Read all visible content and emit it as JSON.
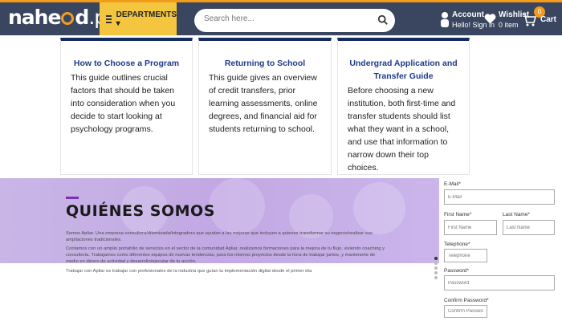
{
  "header": {
    "logo_prefix": "nahe",
    "logo_suffix": "d",
    "logo_tld": ".pk",
    "departments_label": "DEPARTMENTS ▾",
    "search_placeholder": "Search here...",
    "account_label": "Account",
    "account_sub": "Hello! Sign in",
    "wishlist_label": "Wishlist",
    "wishlist_sub": "0 item",
    "cart_label": "Cart",
    "cart_count": "0",
    "colors": {
      "bar": "#3a4660",
      "accent": "#f39b1a",
      "departments_bg": "#f4c63f"
    }
  },
  "cards": [
    {
      "title": "How to Choose a Program",
      "body": "This guide outlines crucial factors that should be taken into consideration when you decide to start looking at psychology programs."
    },
    {
      "title": "Returning to School",
      "body": "This guide gives an overview of credit transfers, prior learning assessments, online degrees, and financial aid for students returning to school."
    },
    {
      "title": "Undergrad Application and Transfer Guide",
      "body": "Before choosing a new institution, both first-time and transfer students should list what they want in a school, and use that information to narrow down their top choices."
    }
  ],
  "hero": {
    "title": "QUIÉNES SOMOS",
    "para1": "Somos Apliar. Una empresa consultora/ditemizada/integradora que ayudan a las mejoras que incluyen a quienes transformar su negocio/realizar sus ampliaciones tradicionales.",
    "para2": "Contamos con un amplio portafolio de servicios en el sector de la comunidad Apliar, realizamos formaciones para la mejora de tu flujo, viviendo coaching y consultoría. Trabajamos como diferentes equipos de nuevas tendencias, para los mismos proyectos desde la hora de trabajar juntos, y mantenerte de medio en dinero de actividad y desarrollo/ejecutar de tu acción.",
    "para3": "Trabajar con Apliar es trabajar con profesionales de la industria que guían tu implementación digital desde el primer día"
  },
  "form": {
    "email_label": "E-Mail*",
    "email_placeholder": "E-Mail",
    "first_label": "First Name*",
    "first_placeholder": "First Name",
    "last_label": "Last Name*",
    "last_placeholder": "Last Name",
    "phone_label": "Telephone*",
    "phone_placeholder": "Telephone",
    "password_label": "Password*",
    "password_placeholder": "Password",
    "confirm_label": "Confirm Password*",
    "confirm_placeholder": "Confirm Password"
  }
}
